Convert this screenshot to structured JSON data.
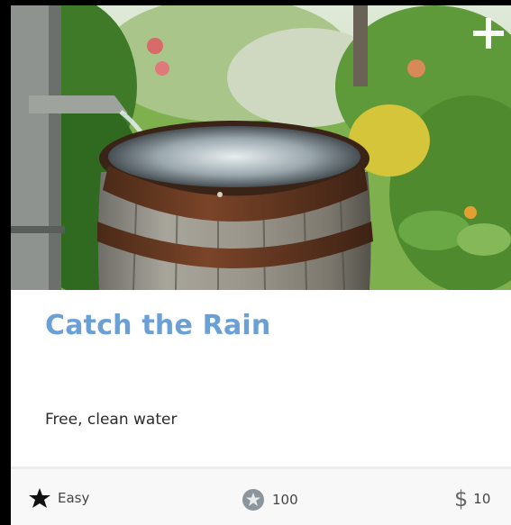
{
  "card": {
    "title": "Catch the Rain",
    "description": "Free, clean water",
    "image_icon": "plus-icon",
    "stats": {
      "difficulty": {
        "icon": "star-icon",
        "label": "Easy"
      },
      "points": {
        "icon": "coin-icon",
        "value": "100"
      },
      "cost": {
        "icon": "dollar-icon",
        "symbol": "$",
        "value": "10"
      }
    }
  },
  "colors": {
    "title": "#6aa0d6",
    "text": "#2c2c2c",
    "footer_bg": "#f8f8f8"
  }
}
